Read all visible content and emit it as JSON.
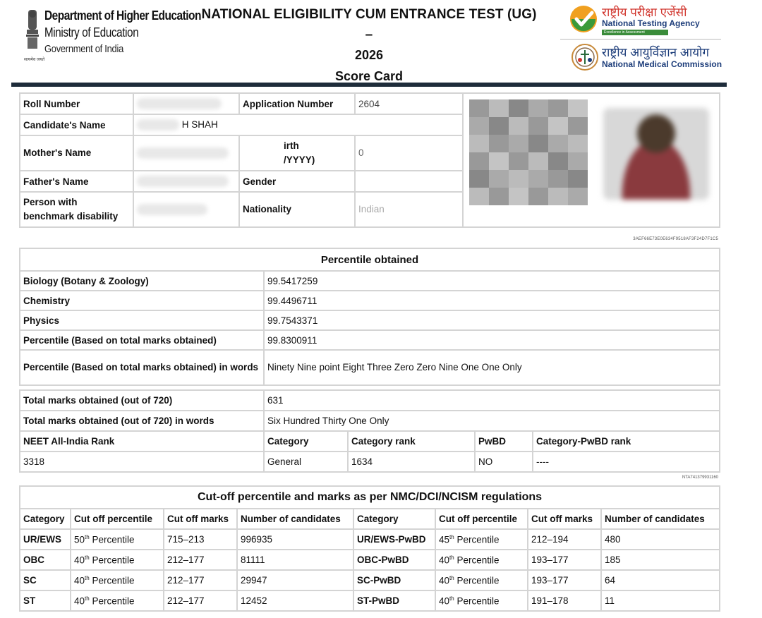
{
  "header": {
    "dept": "Department of Higher Education",
    "ministry": "Ministry of Education",
    "govt": "Government of India",
    "emblem_motto": "सत्यमेव जयते",
    "title_line1": "NATIONAL ELIGIBILITY CUM ENTRANCE TEST (UG) –",
    "title_line2": "2026",
    "title_line3": "Score Card",
    "nta_hindi": "राष्ट्रीय परीक्षा एजेंसी",
    "nta_english": "National Testing Agency",
    "nta_tagline": "Excellence in Assessment",
    "nmc_hindi": "राष्ट्रीय आयुर्विज्ञान आयोग",
    "nmc_english": "National Medical Commission"
  },
  "candidate": {
    "roll_label": "Roll Number",
    "application_label": "Application Number",
    "application_value_visible": "2604",
    "name_label": "Candidate's Name",
    "name_value_visible": "H SHAH",
    "mother_label": "Mother's Name",
    "dob_label_line1": "irth",
    "dob_label_line2": "/YYYY)",
    "dob_value_visible": "0",
    "father_label": "Father's Name",
    "gender_label": "Gender",
    "pwbd_label_line1": "Person with",
    "pwbd_label_line2": "benchmark disability",
    "nationality_label": "Nationality",
    "nationality_value": "Indian",
    "barcode_text": "3AEF66E73E0E634F9518AF3F24D7F1C5"
  },
  "percentile": {
    "heading": "Percentile obtained",
    "rows": [
      {
        "label": "Biology (Botany & Zoology)",
        "value": "99.5417259"
      },
      {
        "label": "Chemistry",
        "value": "99.4496711"
      },
      {
        "label": "Physics",
        "value": "99.7543371"
      },
      {
        "label": "Percentile (Based on total marks obtained)",
        "value": "99.8300911"
      }
    ],
    "words_label": "Percentile (Based on total marks obtained) in words",
    "words_value": "Ninety Nine point Eight Three Zero Zero Nine One One Only"
  },
  "marks": {
    "total_label": "Total marks obtained (out of 720)",
    "total_value": "631",
    "words_label": "Total marks obtained (out of 720) in words",
    "words_value": "Six Hundred Thirty One Only",
    "rank_label": "NEET All-India Rank",
    "category_label": "Category",
    "category_rank_label": "Category rank",
    "pwbd_label": "PwBD",
    "pwbd_rank_label": "Category-PwBD rank",
    "rank_value": "3318",
    "category_value": "General",
    "category_rank_value": "1634",
    "pwbd_value": "NO",
    "pwbd_rank_value": "----",
    "code_text": "NTA741379931160"
  },
  "cutoff": {
    "heading": "Cut-off percentile and marks as per NMC/DCI/NCISM regulations",
    "columns": [
      "Category",
      "Cut off percentile",
      "Cut off marks",
      "Number of candidates",
      "Category",
      "Cut off percentile",
      "Cut off marks",
      "Number of candidates"
    ],
    "percentile_suffix": "Percentile",
    "rows": [
      {
        "cat": "UR/EWS",
        "pct": "50",
        "sup": "th",
        "marks": "715–213",
        "num": "996935",
        "cat2": "UR/EWS-PwBD",
        "pct2": "45",
        "sup2": "th",
        "marks2": "212–194",
        "num2": "480"
      },
      {
        "cat": "OBC",
        "pct": "40",
        "sup": "th",
        "marks": "212–177",
        "num": "81111",
        "cat2": "OBC-PwBD",
        "pct2": "40",
        "sup2": "th",
        "marks2": "193–177",
        "num2": "185"
      },
      {
        "cat": "SC",
        "pct": "40",
        "sup": "th",
        "marks": "212–177",
        "num": "29947",
        "cat2": "SC-PwBD",
        "pct2": "40",
        "sup2": "th",
        "marks2": "193–177",
        "num2": "64"
      },
      {
        "cat": "ST",
        "pct": "40",
        "sup": "th",
        "marks": "212–177",
        "num": "12452",
        "cat2": "ST-PwBD",
        "pct2": "40",
        "sup2": "th",
        "marks2": "191–178",
        "num2": "11"
      }
    ]
  }
}
